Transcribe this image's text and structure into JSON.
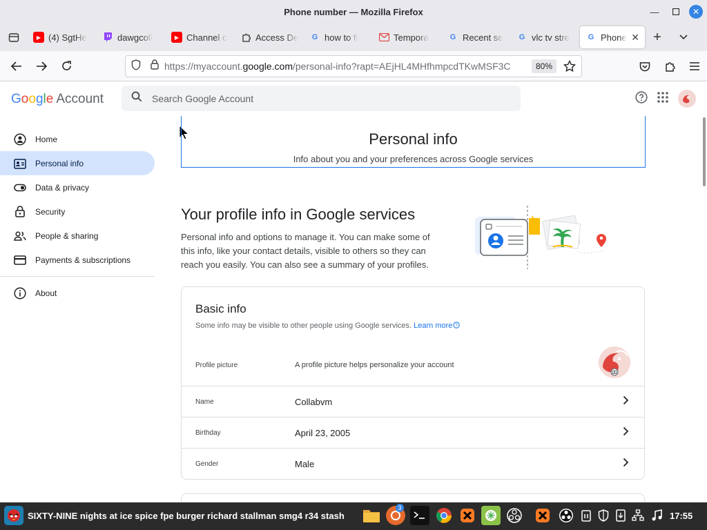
{
  "window": {
    "title": "Phone number — Mozilla Firefox"
  },
  "tabs": [
    {
      "label": "(4) SgtHe",
      "icon": "youtube-icon"
    },
    {
      "label": "dawgcoll",
      "icon": "twitch-icon"
    },
    {
      "label": "Channel c",
      "icon": "youtube-icon"
    },
    {
      "label": "Access De",
      "icon": "puzzle-icon"
    },
    {
      "label": "how to fi",
      "icon": "google-icon"
    },
    {
      "label": "Tempora",
      "icon": "mail-icon"
    },
    {
      "label": "Recent se",
      "icon": "google-icon"
    },
    {
      "label": "vlc tv stre",
      "icon": "google-icon"
    },
    {
      "label": "Phone",
      "icon": "google-icon",
      "active": true
    }
  ],
  "navbar": {
    "url_prefix": "https://myaccount.",
    "url_host": "google.com",
    "url_suffix": "/personal-info?rapt=AEjHL4MHfhmpcdTKwMSF3C",
    "zoom": "80%"
  },
  "header": {
    "logo_letters": [
      "G",
      "o",
      "o",
      "g",
      "l",
      "e"
    ],
    "logo_suffix": "Account",
    "search_placeholder": "Search Google Account"
  },
  "sidebar": {
    "items": [
      {
        "label": "Home",
        "icon": "home-icon"
      },
      {
        "label": "Personal info",
        "icon": "badge-icon",
        "active": true
      },
      {
        "label": "Data & privacy",
        "icon": "toggle-icon"
      },
      {
        "label": "Security",
        "icon": "lock-icon"
      },
      {
        "label": "People & sharing",
        "icon": "people-icon"
      },
      {
        "label": "Payments & subscriptions",
        "icon": "card-icon"
      }
    ],
    "about": {
      "label": "About",
      "icon": "info-icon"
    }
  },
  "main": {
    "title": "Personal info",
    "subtitle": "Info about you and your preferences across Google services",
    "profile_heading": "Your profile info in Google services",
    "profile_text": "Personal info and options to manage it. You can make some of this info, like your contact details, visible to others so they can reach you easily. You can also see a summary of your profiles.",
    "basic_info": {
      "title": "Basic info",
      "subtitle": "Some info may be visible to other people using Google services.",
      "learn_more": "Learn more",
      "rows": [
        {
          "label": "Profile picture",
          "value": "A profile picture helps personalize your account"
        },
        {
          "label": "Name",
          "value": "Collabvm"
        },
        {
          "label": "Birthday",
          "value": "April 23, 2005"
        },
        {
          "label": "Gender",
          "value": "Male"
        }
      ]
    }
  },
  "taskbar": {
    "window_title": "SIXTY-NINE nights at ice spice fpe burger richard stallman smg4 r34 stash",
    "badge_count": "3",
    "clock": "17:55"
  }
}
